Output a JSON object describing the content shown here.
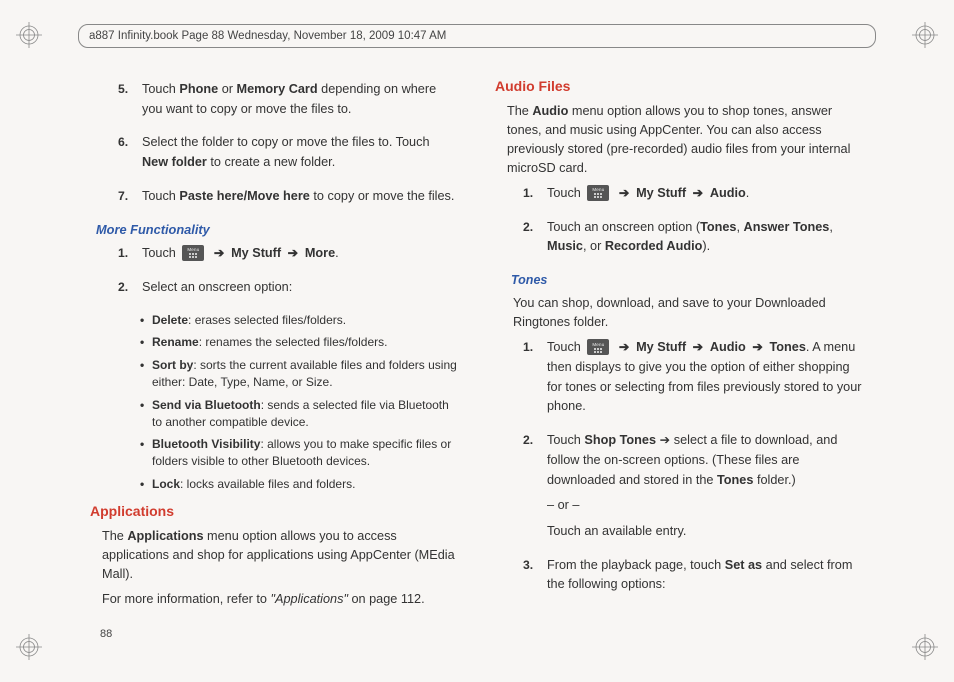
{
  "header": "a887 Infinity.book  Page 88  Wednesday, November 18, 2009  10:47 AM",
  "pageNumber": "88",
  "arrow": "➔",
  "menuLabel": "Menu",
  "left": {
    "steps": [
      {
        "n": "5.",
        "pre": "Touch ",
        "b1": "Phone",
        "mid": " or ",
        "b2": "Memory Card",
        "post": " depending on where you want to copy or move the files to."
      },
      {
        "n": "6.",
        "pre": "Select the folder to copy or move the files to. Touch ",
        "b1": "New folder",
        "post": " to create a new folder."
      },
      {
        "n": "7.",
        "pre": "Touch ",
        "b1": "Paste here/Move here",
        "post": " to copy or move the files."
      }
    ],
    "moreFunc": {
      "heading": "More Functionality",
      "s1": {
        "n": "1.",
        "pre": "Touch ",
        "pathA": "My Stuff",
        "pathB": "More",
        "post": "."
      },
      "s2": {
        "n": "2.",
        "text": "Select an onscreen option:"
      },
      "bullets": [
        {
          "b": "Delete",
          "t": ": erases selected files/folders."
        },
        {
          "b": "Rename",
          "t": ": renames the selected files/folders."
        },
        {
          "b": "Sort by",
          "t": ": sorts the current available files and folders using either: Date, Type, Name, or Size."
        },
        {
          "b": "Send via Bluetooth",
          "t": ": sends a selected file via Bluetooth to another compatible device."
        },
        {
          "b": "Bluetooth Visibility",
          "t": ": allows you to make specific files or folders visible to other Bluetooth devices."
        },
        {
          "b": "Lock",
          "t": ": locks available files and folders."
        }
      ]
    },
    "apps": {
      "heading": "Applications",
      "para": {
        "pre": "The ",
        "b": "Applications",
        "post": " menu option allows you to access applications and shop for applications using AppCenter (MEdia Mall)."
      },
      "xref": {
        "pre": "For more information, refer to ",
        "it": "\"Applications\"",
        "post": "  on page 112."
      }
    }
  },
  "right": {
    "audio": {
      "heading": "Audio Files",
      "para": {
        "pre": "The ",
        "b": "Audio",
        "post": " menu option allows you to shop tones, answer tones, and music using AppCenter. You can also access previously stored (pre-recorded) audio files from your internal microSD card."
      },
      "s1": {
        "n": "1.",
        "pre": "Touch ",
        "pathA": "My Stuff",
        "pathB": "Audio",
        "post": "."
      },
      "s2": {
        "n": "2.",
        "pre": "Touch an onscreen option (",
        "b1": "Tones",
        "c1": ", ",
        "b2": "Answer Tones",
        "c2": ", ",
        "b3": "Music",
        "c3": ", or ",
        "b4": "Recorded Audio",
        "post": ")."
      }
    },
    "tones": {
      "heading": "Tones",
      "para": "You can shop, download, and save to your Downloaded Ringtones folder.",
      "s1": {
        "n": "1.",
        "pre": "Touch ",
        "pathA": "My Stuff",
        "pathB": "Audio",
        "pathC": "Tones",
        "post": ". A menu then displays to give you the option of either shopping for tones or selecting from files previously stored to your phone."
      },
      "s2": {
        "n": "2.",
        "pre": "Touch ",
        "b1": "Shop Tones",
        "mid": " ➔ select a file to download, and follow the on-screen options. (These files are downloaded and stored in the ",
        "b2": "Tones",
        "post": " folder.)",
        "or": "– or –",
        "alt": "Touch an available entry."
      },
      "s3": {
        "n": "3.",
        "pre": "From the playback page, touch ",
        "b1": "Set as",
        "post": " and select from the following options:"
      }
    }
  }
}
